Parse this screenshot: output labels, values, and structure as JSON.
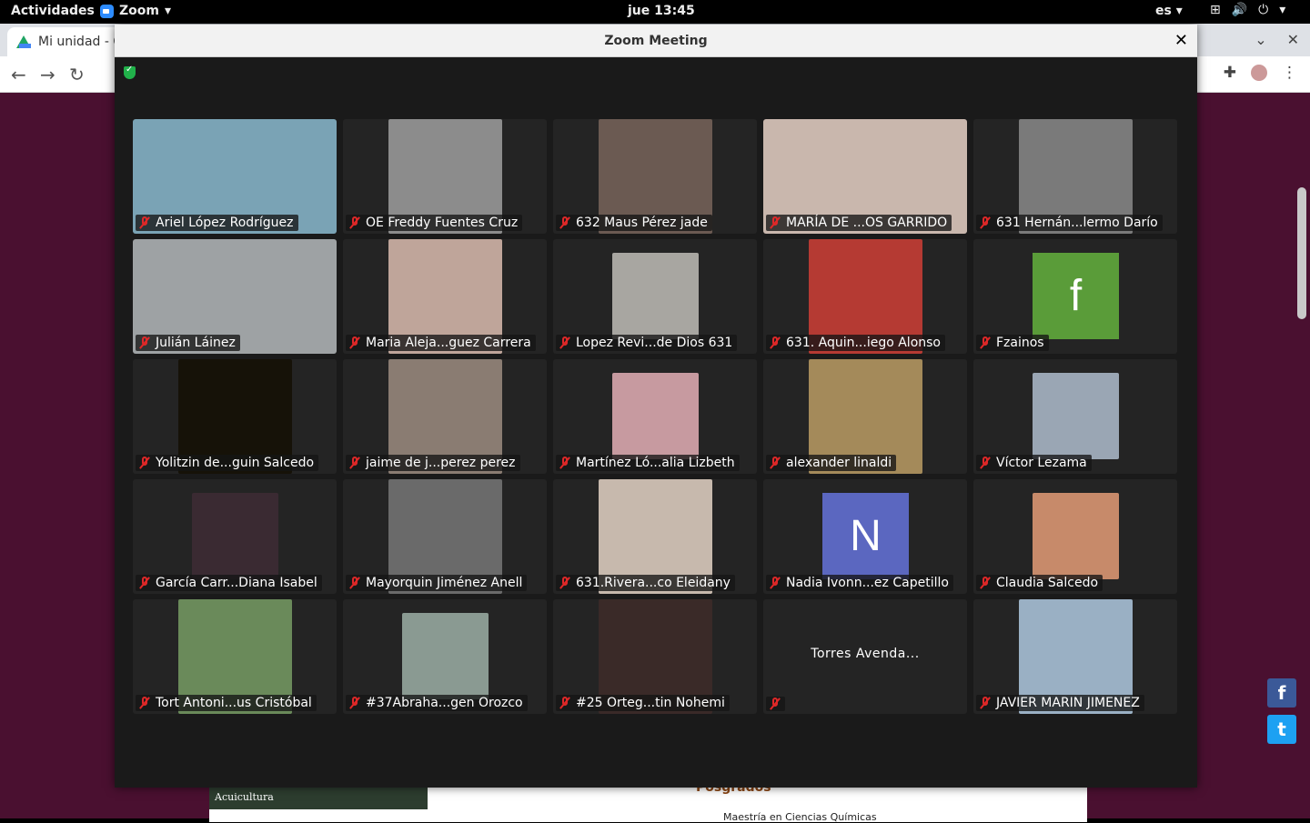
{
  "topbar": {
    "activities": "Actividades",
    "app_name": "Zoom",
    "clock": "jue 13:45",
    "language": "es"
  },
  "browser": {
    "tab_title": "Mi unidad - G",
    "page": {
      "sidebar_item": "Acuicultura",
      "section_heading": "Posgrados",
      "list_item": "Maestría en Ciencias Químicas"
    }
  },
  "zoom": {
    "window_title": "Zoom Meeting",
    "participants": [
      {
        "name": "Ariel López Rodríguez",
        "video": "full",
        "color": "#7aa3b5",
        "muted": true
      },
      {
        "name": "OE Freddy Fuentes Cruz",
        "video": "portrait",
        "color": "#8c8c8c",
        "muted": true
      },
      {
        "name": "632 Maus Pérez jade",
        "video": "portrait",
        "color": "#6b5a52",
        "muted": true
      },
      {
        "name": "MARÍA DE ...OS GARRIDO",
        "video": "full",
        "color": "#c9b7ad",
        "muted": true
      },
      {
        "name": "631 Hernán...lermo Darío",
        "video": "portrait",
        "color": "#7a7a7a",
        "muted": true
      },
      {
        "name": "Julián Láinez",
        "video": "full",
        "color": "#9ea2a4",
        "muted": true
      },
      {
        "name": "Maria Aleja...guez Carrera",
        "video": "portrait",
        "color": "#bfa59a",
        "muted": true
      },
      {
        "name": "Lopez Revi...de Dios 631",
        "video": "square",
        "color": "#a8a6a1",
        "muted": true
      },
      {
        "name": "631. Aquin...iego Alonso",
        "video": "portrait",
        "color": "#b53a33",
        "muted": true
      },
      {
        "name": "Fzainos",
        "avatar_letter": "f",
        "avatar_color": "#5a9c39",
        "muted": true
      },
      {
        "name": "Yolitzin de...guin Salcedo",
        "video": "portrait",
        "color": "#161208",
        "muted": true
      },
      {
        "name": "jaime de j...perez perez",
        "video": "portrait",
        "color": "#8a7c72",
        "muted": true
      },
      {
        "name": "Martínez Ló...alia Lizbeth",
        "video": "square",
        "color": "#c79aa0",
        "muted": true
      },
      {
        "name": "alexander linaldi",
        "video": "portrait",
        "color": "#a48a5a",
        "muted": true
      },
      {
        "name": "Víctor Lezama",
        "video": "square",
        "color": "#9aa6b4",
        "muted": true
      },
      {
        "name": "García Carr...Diana Isabel",
        "video": "square",
        "color": "#3a2a32",
        "muted": true
      },
      {
        "name": "Mayorquin Jiménez Anell",
        "video": "portrait",
        "color": "#6a6a6a",
        "muted": true
      },
      {
        "name": "631.Rivera...co Eleidany",
        "video": "portrait",
        "color": "#c7b9ad",
        "muted": true
      },
      {
        "name": "Nadia Ivonn...ez Capetillo",
        "avatar_letter": "N",
        "avatar_color": "#5b67c0",
        "muted": true
      },
      {
        "name": "Claudia Salcedo",
        "video": "square",
        "color": "#c78a6a",
        "muted": true
      },
      {
        "name": "Tort Antoni...us Cristóbal",
        "video": "portrait",
        "color": "#6a8a5a",
        "muted": true
      },
      {
        "name": "#37Abraha...gen Orozco",
        "video": "square",
        "color": "#8a9a92",
        "muted": true
      },
      {
        "name": "#25 Orteg...tin Nohemi",
        "video": "portrait",
        "color": "#3a2a28",
        "muted": true
      },
      {
        "name": "",
        "center_name": "Torres Avenda...",
        "muted": true
      },
      {
        "name": "JAVIER MARIN JIMENEZ",
        "video": "portrait",
        "color": "#9ab0c4",
        "muted": true
      }
    ]
  }
}
